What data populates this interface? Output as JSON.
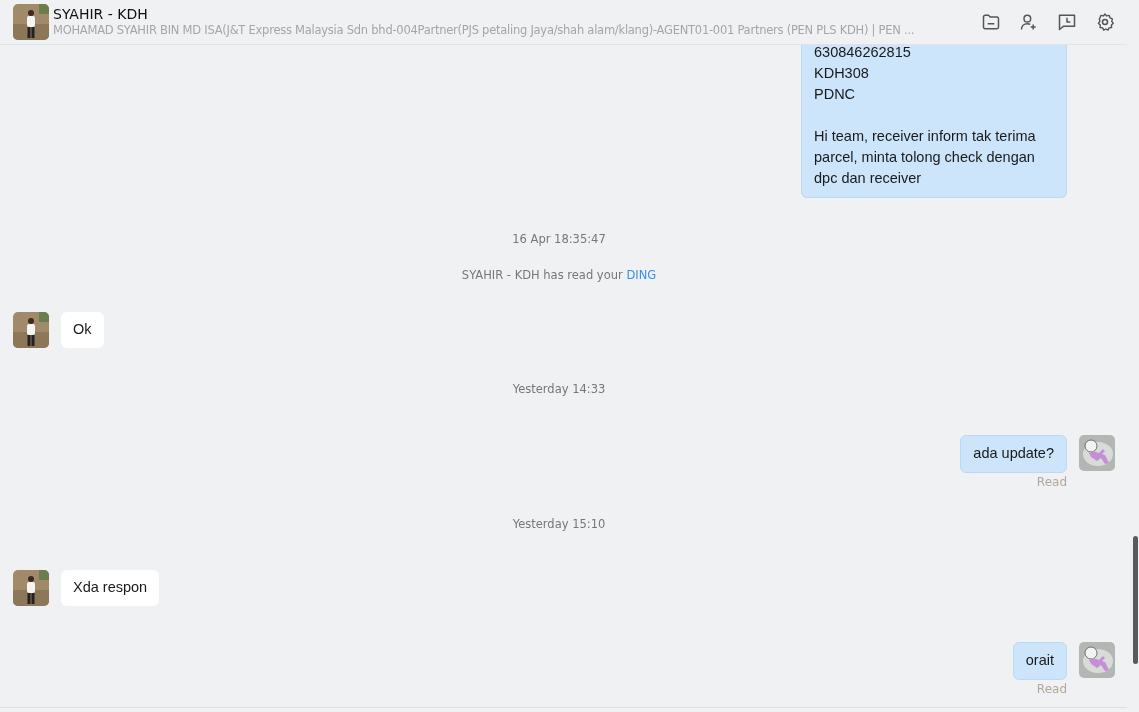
{
  "header": {
    "title": "SYAHIR - KDH",
    "subtitle": "MOHAMAD SYAHIR BIN MD ISA(J&T Express Malaysia Sdn bhd-004Partner(PJS petaling Jaya/shah alam/klang)-AGENT01-001 Partners (PEN PLS KDH) | PEN ..."
  },
  "messages": [
    {
      "kind": "outgoing",
      "lines": [
        "630846262815",
        "KDH308",
        "PDNC"
      ],
      "more": "Hi team, receiver inform tak terima parcel, minta tolong check dengan dpc dan receiver",
      "cut": true
    },
    {
      "kind": "time",
      "text": "16 Apr 18:35:47"
    },
    {
      "kind": "notice",
      "text": "SYAHIR - KDH has read your",
      "link": "DING"
    },
    {
      "kind": "incoming",
      "lines": [
        "Ok"
      ]
    },
    {
      "kind": "time",
      "text": "Yesterday 14:33"
    },
    {
      "kind": "outgoing",
      "lines": [
        "ada update?"
      ],
      "status": "Read"
    },
    {
      "kind": "time",
      "text": "Yesterday 15:10"
    },
    {
      "kind": "incoming",
      "lines": [
        "Xda respon"
      ]
    },
    {
      "kind": "outgoing",
      "lines": [
        "orait"
      ],
      "status": "Read"
    }
  ]
}
